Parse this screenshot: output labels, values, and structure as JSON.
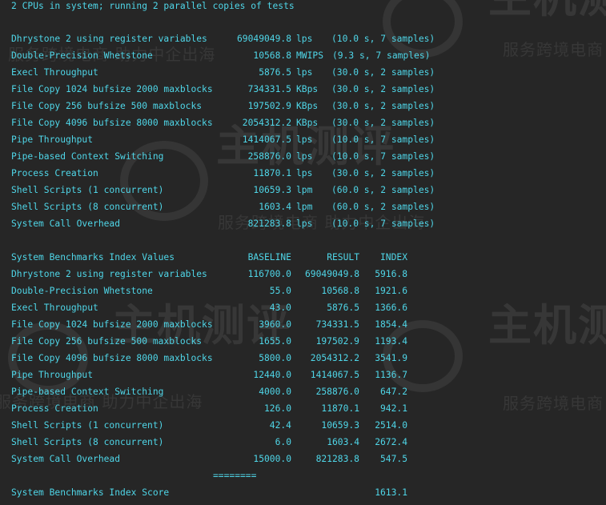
{
  "terminal": {
    "header": "2 CPUs in system; running 2 parallel copies of tests",
    "results": [
      {
        "name": "Dhrystone 2 using register variables",
        "value": "69049049.8",
        "unit": "lps",
        "detail": "(10.0 s, 7 samples)"
      },
      {
        "name": "Double-Precision Whetstone",
        "value": "10568.8",
        "unit": "MWIPS",
        "detail": "(9.3 s, 7 samples)"
      },
      {
        "name": "Execl Throughput",
        "value": "5876.5",
        "unit": "lps",
        "detail": "(30.0 s, 2 samples)"
      },
      {
        "name": "File Copy 1024 bufsize 2000 maxblocks",
        "value": "734331.5",
        "unit": "KBps",
        "detail": "(30.0 s, 2 samples)"
      },
      {
        "name": "File Copy 256 bufsize 500 maxblocks",
        "value": "197502.9",
        "unit": "KBps",
        "detail": "(30.0 s, 2 samples)"
      },
      {
        "name": "File Copy 4096 bufsize 8000 maxblocks",
        "value": "2054312.2",
        "unit": "KBps",
        "detail": "(30.0 s, 2 samples)"
      },
      {
        "name": "Pipe Throughput",
        "value": "1414067.5",
        "unit": "lps",
        "detail": "(10.0 s, 7 samples)"
      },
      {
        "name": "Pipe-based Context Switching",
        "value": "258876.0",
        "unit": "lps",
        "detail": "(10.0 s, 7 samples)"
      },
      {
        "name": "Process Creation",
        "value": "11870.1",
        "unit": "lps",
        "detail": "(30.0 s, 2 samples)"
      },
      {
        "name": "Shell Scripts (1 concurrent)",
        "value": "10659.3",
        "unit": "lpm",
        "detail": "(60.0 s, 2 samples)"
      },
      {
        "name": "Shell Scripts (8 concurrent)",
        "value": "1603.4",
        "unit": "lpm",
        "detail": "(60.0 s, 2 samples)"
      },
      {
        "name": "System Call Overhead",
        "value": "821283.8",
        "unit": "lps",
        "detail": "(10.0 s, 7 samples)"
      }
    ],
    "index_table": {
      "title": "System Benchmarks Index Values",
      "col_baseline": "BASELINE",
      "col_result": "RESULT",
      "col_index": "INDEX",
      "rows": [
        {
          "name": "Dhrystone 2 using register variables",
          "baseline": "116700.0",
          "result": "69049049.8",
          "index": "5916.8"
        },
        {
          "name": "Double-Precision Whetstone",
          "baseline": "55.0",
          "result": "10568.8",
          "index": "1921.6"
        },
        {
          "name": "Execl Throughput",
          "baseline": "43.0",
          "result": "5876.5",
          "index": "1366.6"
        },
        {
          "name": "File Copy 1024 bufsize 2000 maxblocks",
          "baseline": "3960.0",
          "result": "734331.5",
          "index": "1854.4"
        },
        {
          "name": "File Copy 256 bufsize 500 maxblocks",
          "baseline": "1655.0",
          "result": "197502.9",
          "index": "1193.4"
        },
        {
          "name": "File Copy 4096 bufsize 8000 maxblocks",
          "baseline": "5800.0",
          "result": "2054312.2",
          "index": "3541.9"
        },
        {
          "name": "Pipe Throughput",
          "baseline": "12440.0",
          "result": "1414067.5",
          "index": "1136.7"
        },
        {
          "name": "Pipe-based Context Switching",
          "baseline": "4000.0",
          "result": "258876.0",
          "index": "647.2"
        },
        {
          "name": "Process Creation",
          "baseline": "126.0",
          "result": "11870.1",
          "index": "942.1"
        },
        {
          "name": "Shell Scripts (1 concurrent)",
          "baseline": "42.4",
          "result": "10659.3",
          "index": "2514.0"
        },
        {
          "name": "Shell Scripts (8 concurrent)",
          "baseline": "6.0",
          "result": "1603.4",
          "index": "2672.4"
        },
        {
          "name": "System Call Overhead",
          "baseline": "15000.0",
          "result": "821283.8",
          "index": "547.5"
        }
      ],
      "separator": "========",
      "score_label": "System Benchmarks Index Score",
      "score_value": "1613.1"
    }
  },
  "watermark": {
    "brand": "主机测评",
    "slogan_a": "服务跨境电商 助力中企出海",
    "slogan_b": "服务跨境电商"
  },
  "colors": {
    "background": "#262626",
    "text": "#4fd6e8"
  }
}
